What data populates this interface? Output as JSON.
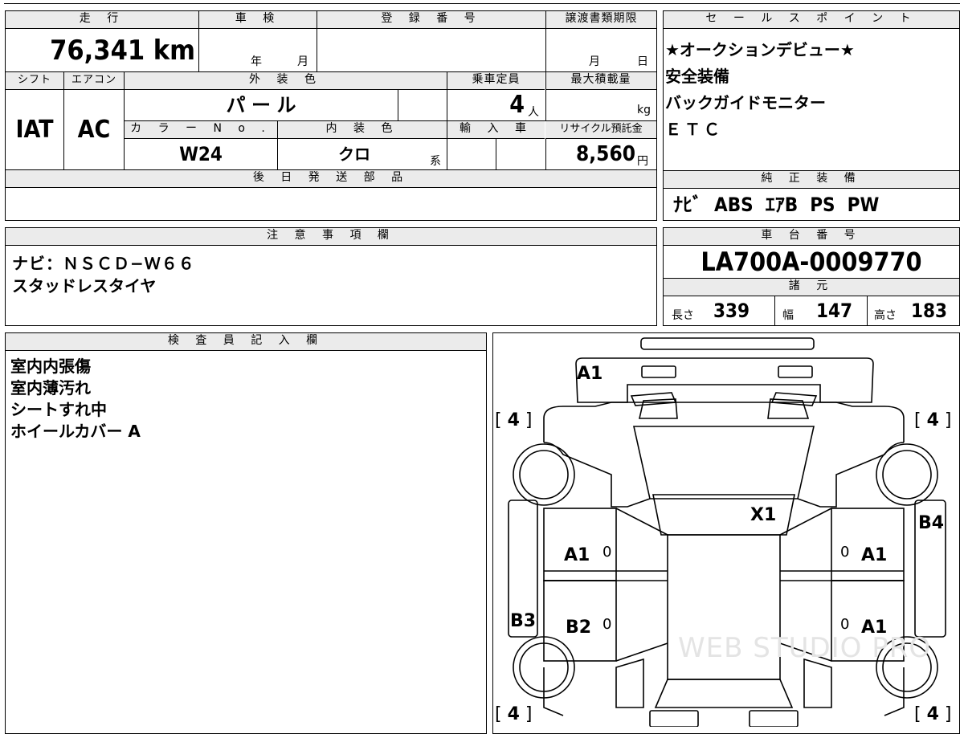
{
  "top_table": {
    "mileage_label": "走 行",
    "mileage": "76,341 km",
    "inspection_label": "車 検",
    "year_unit": "年",
    "month_unit": "月",
    "reg_label": "登 録 番 号",
    "transfer_label": "譲渡書類期限",
    "day_unit": "日",
    "shift_label": "シフト",
    "shift": "IAT",
    "ac_label": "エアコン",
    "ac": "AC",
    "ext_color_label": "外 装 色",
    "ext_color": "パ ー ル",
    "capacity_label": "乗車定員",
    "capacity": "4",
    "capacity_unit": "人",
    "max_load_label": "最大積載量",
    "max_load_unit": "kg",
    "color_no_label": "カ ラ ー N o .",
    "color_no": "W24",
    "int_color_label": "内 装 色",
    "int_color": "クロ",
    "int_color_suffix": "系",
    "import_label": "輸 入 車",
    "recycle_label": "リサイクル預託金",
    "recycle": "8,560",
    "recycle_unit": "円",
    "later_parts_label": "後 日 発 送 部 品"
  },
  "sales_points": {
    "label": "セ ー ル ス ポ イ ン ト",
    "lines": [
      "★オークションデビュー★",
      "安全装備",
      "バックガイドモニター",
      "ＥＴＣ"
    ]
  },
  "genuine_equipment": {
    "label": "純 正 装 備",
    "value": "ﾅﾋﾞ  ABS  ｴｱB  PS  PW"
  },
  "notes": {
    "label": "注 意 事 項 欄",
    "lines": [
      "ナビ：ＮＳＣＤ−Ｗ６６",
      "スタッドレスタイヤ"
    ]
  },
  "chassis": {
    "label": "車 台 番 号",
    "number": "LA700A-0009770",
    "specs_label": "諸 元",
    "length_label": "長さ",
    "length": "339",
    "width_label": "幅",
    "width": "147",
    "height_label": "高さ",
    "height": "183"
  },
  "inspector": {
    "label": "検 査 員 記 入 欄",
    "lines": [
      "室内内張傷",
      "室内薄汚れ",
      "シートすれ中",
      "ホイールカバー A"
    ]
  },
  "diagram": {
    "marks": {
      "front": "A1",
      "roof": "X1",
      "right_rear_side": "B4",
      "left_side": "B3",
      "left_front_door": "A1",
      "left_rear_door": "B2",
      "right_front_door": "A1",
      "right_rear_door": "A1",
      "door_zero": "0"
    },
    "tire_tread": "4",
    "watermark": "WEB STUDIO PRO"
  }
}
